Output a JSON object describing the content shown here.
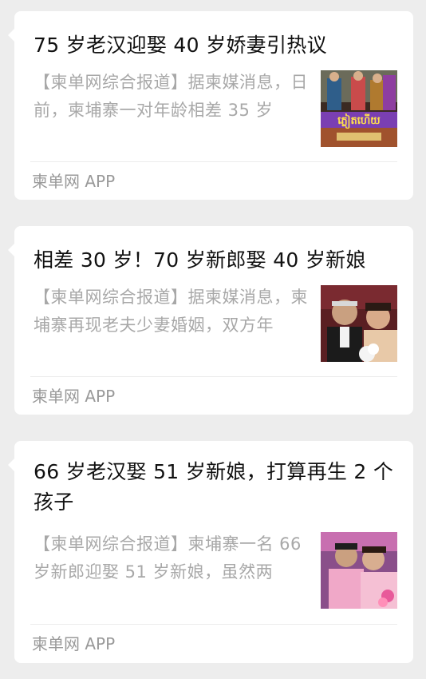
{
  "articles": [
    {
      "title": "75 岁老汉迎娶 40 岁娇妻引热议",
      "summary": "【柬单网综合报道】据柬媒消息，日前，柬埔寨一对年龄相差 35 岁",
      "source": "柬单网 APP",
      "thumbnail_text": "ភ្លៀតហើយ"
    },
    {
      "title": "相差 30 岁！70 岁新郎娶 40 岁新娘",
      "summary": "【柬单网综合报道】据柬媒消息，柬埔寨再现老夫少妻婚姻，双方年",
      "source": "柬单网 APP"
    },
    {
      "title": "66 岁老汉娶 51 岁新娘，打算再生 2 个孩子",
      "summary": "【柬单网综合报道】柬埔寨一名 66 岁新郎迎娶 51 岁新娘，虽然两",
      "source": "柬单网 APP"
    }
  ],
  "colors": {
    "page_background": "#ededed",
    "card_background": "#ffffff",
    "title": "#111111",
    "summary": "#a8a8a8",
    "source": "#999999"
  }
}
